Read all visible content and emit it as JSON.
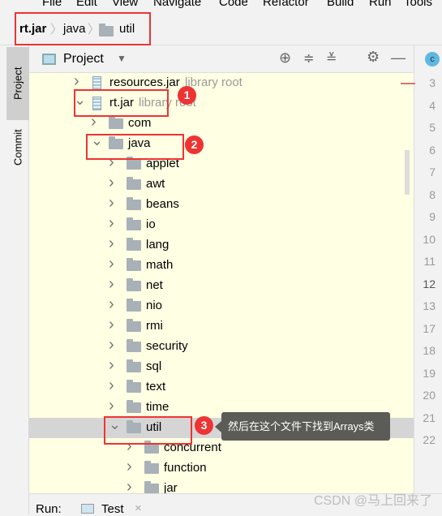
{
  "menu": [
    "File",
    "Edit",
    "View",
    "Navigate",
    "Code",
    "Refactor",
    "Build",
    "Run",
    "Tools"
  ],
  "breadcrumb": [
    "rt.jar",
    "java",
    "util"
  ],
  "tool_stripe": {
    "project": "Project",
    "commit": "Commit"
  },
  "panel": {
    "title": "Project",
    "icons": [
      "locate-icon",
      "expand-all-icon",
      "collapse-all-icon",
      "gear-icon",
      "minimize-icon"
    ]
  },
  "tree": [
    {
      "label": "resources.jar",
      "hint": "library root",
      "type": "jar",
      "level": 0,
      "expanded": false
    },
    {
      "label": "rt.jar",
      "hint": "library root",
      "type": "jar",
      "level": 0,
      "expanded": true
    },
    {
      "label": "com",
      "type": "folder",
      "level": 1,
      "expanded": false
    },
    {
      "label": "java",
      "type": "folder",
      "level": 1,
      "expanded": true
    },
    {
      "label": "applet",
      "type": "folder",
      "level": 2,
      "expanded": false
    },
    {
      "label": "awt",
      "type": "folder",
      "level": 2,
      "expanded": false
    },
    {
      "label": "beans",
      "type": "folder",
      "level": 2,
      "expanded": false
    },
    {
      "label": "io",
      "type": "folder",
      "level": 2,
      "expanded": false
    },
    {
      "label": "lang",
      "type": "folder",
      "level": 2,
      "expanded": false
    },
    {
      "label": "math",
      "type": "folder",
      "level": 2,
      "expanded": false
    },
    {
      "label": "net",
      "type": "folder",
      "level": 2,
      "expanded": false
    },
    {
      "label": "nio",
      "type": "folder",
      "level": 2,
      "expanded": false
    },
    {
      "label": "rmi",
      "type": "folder",
      "level": 2,
      "expanded": false
    },
    {
      "label": "security",
      "type": "folder",
      "level": 2,
      "expanded": false
    },
    {
      "label": "sql",
      "type": "folder",
      "level": 2,
      "expanded": false
    },
    {
      "label": "text",
      "type": "folder",
      "level": 2,
      "expanded": false
    },
    {
      "label": "time",
      "type": "folder",
      "level": 2,
      "expanded": false
    },
    {
      "label": "util",
      "type": "folder",
      "level": 2,
      "expanded": true,
      "selected": true
    },
    {
      "label": "concurrent",
      "type": "folder",
      "level": 3,
      "expanded": false
    },
    {
      "label": "function",
      "type": "folder",
      "level": 3,
      "expanded": false
    },
    {
      "label": "jar",
      "type": "folder",
      "level": 3,
      "expanded": false
    }
  ],
  "gutter_lines": [
    "3",
    "4",
    "5",
    "6",
    "7",
    "8",
    "9",
    "10",
    "11",
    "12",
    "13",
    "17",
    "18",
    "19",
    "20",
    "21",
    "22"
  ],
  "annotations": {
    "badges": [
      "1",
      "2",
      "3"
    ],
    "tooltip": "然后在这个文件下找到Arrays类"
  },
  "run_bar": {
    "label": "Run:",
    "tab": "Test"
  },
  "watermark": "CSDN @马上回来了",
  "colors": {
    "tree_bg": "#ffffe4",
    "selection": "#d5d5d5",
    "annotation_red": "#ee3333",
    "tooltip_bg": "#5b5b58"
  }
}
